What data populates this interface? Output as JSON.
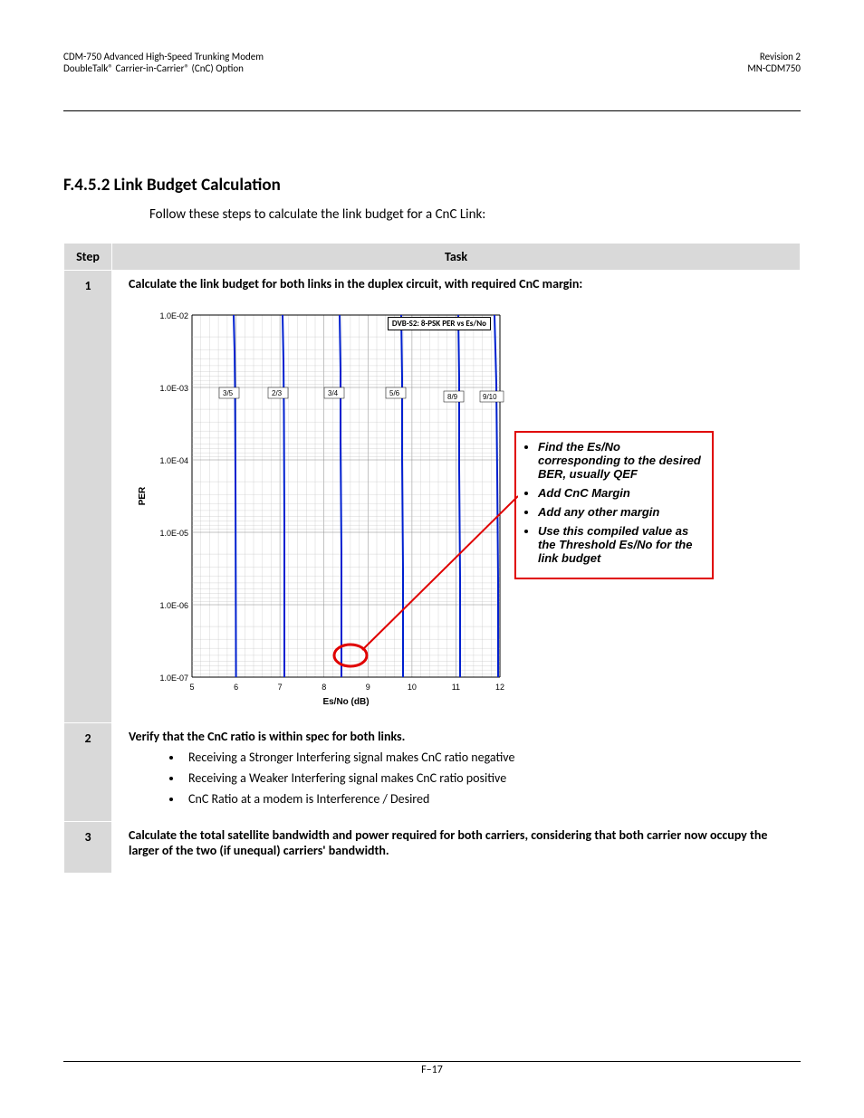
{
  "header": {
    "left_line1": "CDM-750 Advanced High-Speed Trunking Modem",
    "left_line2": "DoubleTalk® Carrier-in-Carrier® (CnC) Option",
    "right_line1": "Revision 2",
    "right_line2": "MN-CDM750"
  },
  "section_heading": "F.4.5.2 Link Budget Calculation",
  "intro": "Follow these steps to calculate the link budget for a CnC Link:",
  "table": {
    "head_step": "Step",
    "head_task": "Task",
    "rows": [
      {
        "num": "1",
        "title": "Calculate the link budget for both links in the duplex circuit, with required CnC margin:"
      },
      {
        "num": "2",
        "title": "Verify that the CnC ratio is within spec for both links.",
        "bullets": [
          "Receiving a Stronger Interfering signal makes CnC ratio negative",
          "Receiving a Weaker Interfering signal makes CnC ratio positive",
          "CnC Ratio at a modem is Interference / Desired"
        ]
      },
      {
        "num": "3",
        "title": "Calculate the total satellite bandwidth and power required for both carriers, considering that both carrier now occupy the larger of the two (if unequal) carriers' bandwidth."
      }
    ]
  },
  "callout": {
    "items": [
      "Find the Es/No corresponding to the desired BER, usually QEF",
      "Add CnC Margin",
      "Add any other margin",
      "Use this compiled value as the Threshold Es/No for the link budget"
    ]
  },
  "chart_data": {
    "type": "line",
    "title": "DVB-S2: 8-PSK PER vs Es/No",
    "xlabel": "Es/No (dB)",
    "ylabel": "PER",
    "xlim": [
      5,
      12
    ],
    "ylim_log": [
      1e-07,
      0.01
    ],
    "x_ticks": [
      5,
      6,
      7,
      8,
      9,
      10,
      11,
      12
    ],
    "y_ticks": [
      "1.0E-02",
      "1.0E-03",
      "1.0E-04",
      "1.0E-05",
      "1.0E-06",
      "1.0E-07"
    ],
    "series": [
      {
        "name": "3/5",
        "x_at_qef": 6.0
      },
      {
        "name": "2/3",
        "x_at_qef": 7.1
      },
      {
        "name": "3/4",
        "x_at_qef": 8.4
      },
      {
        "name": "5/6",
        "x_at_qef": 9.8
      },
      {
        "name": "8/9",
        "x_at_qef": 11.1
      },
      {
        "name": "9/10",
        "x_at_qef": 12.0
      }
    ],
    "highlight_point": {
      "x": 8.6,
      "y_exp": -6.6
    }
  },
  "footer": {
    "page": "F–17"
  }
}
